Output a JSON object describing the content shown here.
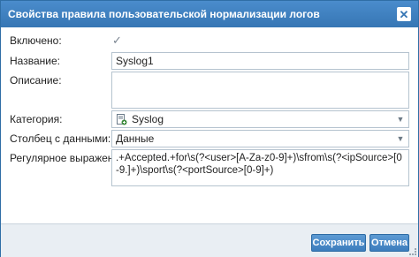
{
  "dialog": {
    "title": "Свойства правила пользовательской нормализации логов",
    "close_icon": "close-icon"
  },
  "form": {
    "enabled": {
      "label": "Включено:",
      "checked": true,
      "icon": "checkmark-icon"
    },
    "name": {
      "label": "Название:",
      "value": "Syslog1"
    },
    "description": {
      "label": "Описание:",
      "value": ""
    },
    "category": {
      "label": "Категория:",
      "value": "Syslog",
      "icon": "category-doc-icon"
    },
    "data_column": {
      "label": "Столбец с данными:",
      "value": "Данные"
    },
    "regex": {
      "label": "Регулярное выражение:",
      "value": ".+Accepted.+for\\s(?<user>[A-Za-z0-9]+)\\sfrom\\s(?<ipSource>[0-9.]+)\\sport\\s(?<portSource>[0-9]+)"
    }
  },
  "buttons": {
    "save": "Сохранить",
    "cancel": "Отмена"
  },
  "colors": {
    "titlebar": "#3b7fc0",
    "button": "#3c7dbd",
    "footer": "#e9eef3"
  }
}
